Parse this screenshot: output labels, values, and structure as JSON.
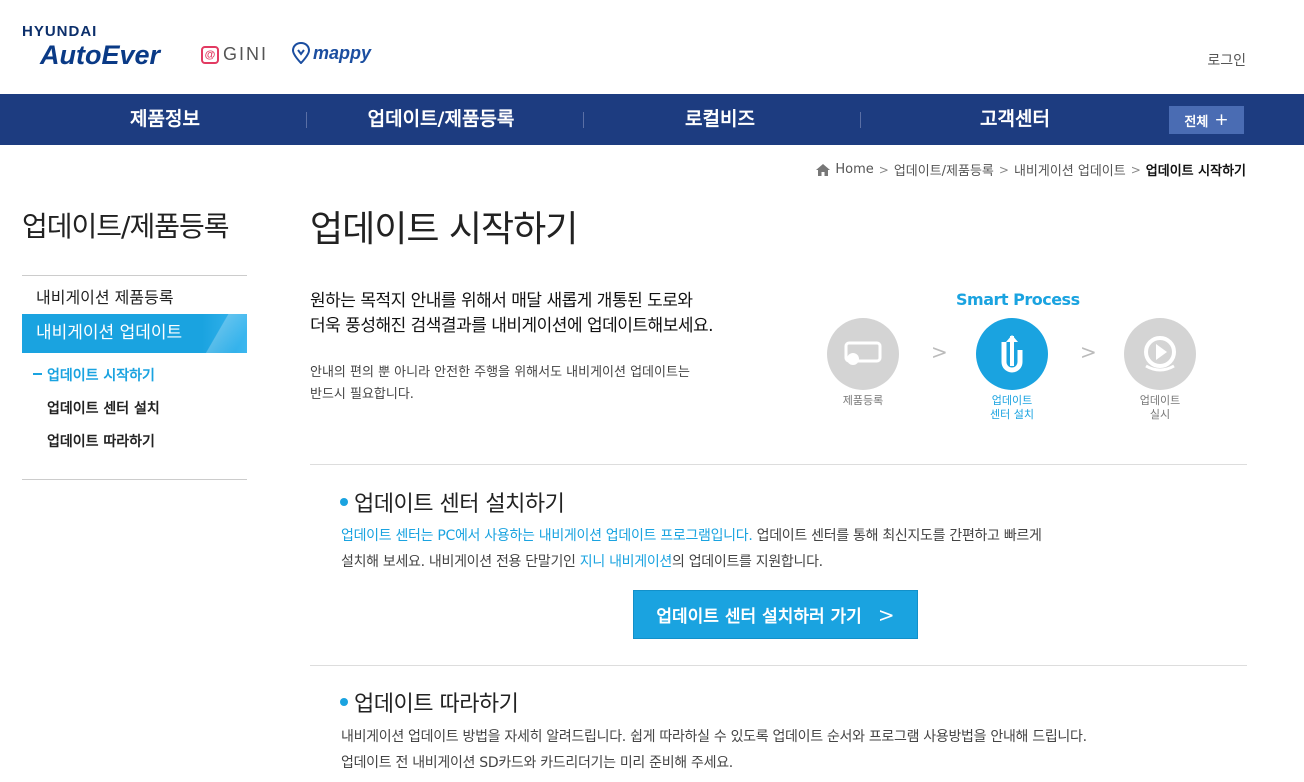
{
  "header": {
    "brand_top": "HYUNDAI",
    "brand_main": "AutoEver",
    "gini_text": "GINI",
    "mappy_text": "mappy",
    "login": "로그인"
  },
  "nav": {
    "items": [
      "제품정보",
      "업데이트/제품등록",
      "로컬비즈",
      "고객센터"
    ],
    "all_label": "전체",
    "all_plus": "+"
  },
  "breadcrumb": {
    "items": [
      "Home",
      "업데이트/제품등록",
      "내비게이션 업데이트",
      "업데이트 시작하기"
    ],
    "separator": ">"
  },
  "sidebar": {
    "title": "업데이트/제품등록",
    "items": [
      {
        "label": "내비게이션 제품등록"
      },
      {
        "label": "내비게이션 업데이트"
      }
    ],
    "sub_items": [
      {
        "label": "업데이트 시작하기"
      },
      {
        "label": "업데이트 센터 설치"
      },
      {
        "label": "업데이트 따라하기"
      }
    ]
  },
  "main": {
    "title": "업데이트 시작하기",
    "intro_line1": "원하는 목적지 안내를 위해서 매달 새롭게 개통된 도로와",
    "intro_line2": "더욱 풍성해진 검색결과를 내비게이션에 업데이트해보세요.",
    "intro_sub1": "안내의 편의 뿐 아니라 안전한 주행을 위해서도 내비게이션 업데이트는",
    "intro_sub2": "반드시 필요합니다."
  },
  "smart_process": {
    "title": "Smart Process",
    "steps": [
      {
        "line1": "제품등록",
        "line2": "",
        "icon": "product-register-icon"
      },
      {
        "line1": "업데이트",
        "line2": "센터 설치",
        "icon": "update-center-icon"
      },
      {
        "line1": "업데이트",
        "line2": "실시",
        "icon": "update-run-icon"
      }
    ],
    "arrow": ">"
  },
  "section1": {
    "title": "업데이트 센터 설치하기",
    "text1_hl": "업데이트 센터는 PC에서 사용하는 내비게이션 업데이트 프로그램입니다.",
    "text1_rest": " 업데이트 센터를 통해 최신지도를 간편하고 빠르게",
    "text2_pre": "설치해 보세요. 내비게이션 전용 단말기인 ",
    "text2_hl": "지니 내비게이션",
    "text2_rest": "의 업데이트를 지원합니다.",
    "button": "업데이트 센터 설치하러 가기",
    "button_chev": ">"
  },
  "section2": {
    "title": "업데이트 따라하기",
    "text1": "내비게이션 업데이트 방법을 자세히 알려드립니다. 쉽게 따라하실 수 있도록 업데이트 순서와 프로그램 사용방법을 안내해 드립니다.",
    "text2": "업데이트 전 내비게이션 SD카드와 카드리더기는 미리 준비해 주세요."
  },
  "colors": {
    "nav_bg": "#1d3c80",
    "accent": "#1aa3e0",
    "nav_all_bg": "#4a6cb3"
  }
}
